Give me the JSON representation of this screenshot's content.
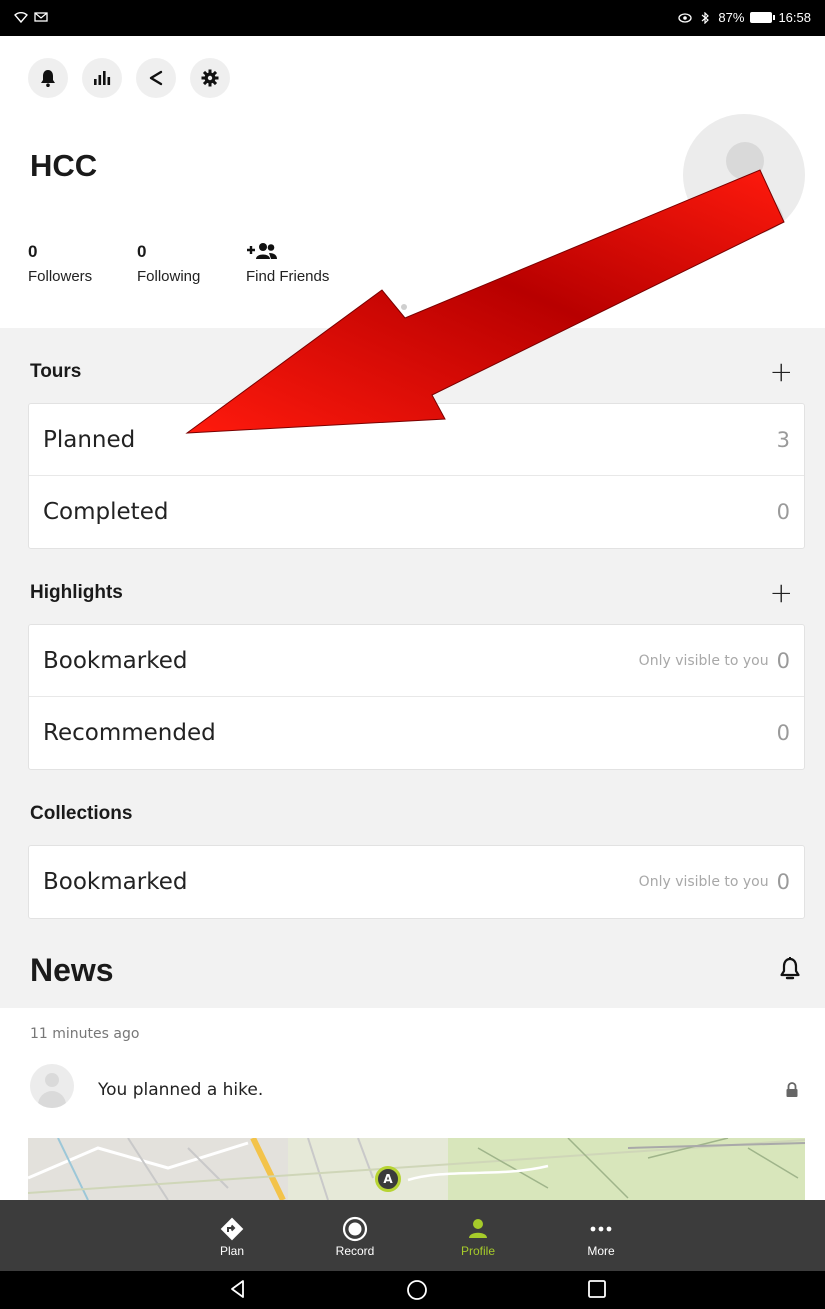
{
  "status_bar": {
    "battery": "87%",
    "time": "16:58"
  },
  "profile": {
    "username": "HCC",
    "followers_count": "0",
    "followers_label": "Followers",
    "following_count": "0",
    "following_label": "Following",
    "find_friends_label": "Find Friends"
  },
  "tours": {
    "title": "Tours",
    "rows": [
      {
        "label": "Planned",
        "count": "3"
      },
      {
        "label": "Completed",
        "count": "0"
      }
    ]
  },
  "highlights": {
    "title": "Highlights",
    "rows": [
      {
        "label": "Bookmarked",
        "note": "Only visible to you",
        "count": "0"
      },
      {
        "label": "Recommended",
        "count": "0"
      }
    ]
  },
  "collections": {
    "title": "Collections",
    "rows": [
      {
        "label": "Bookmarked",
        "note": "Only visible to you",
        "count": "0"
      }
    ]
  },
  "news": {
    "title": "News",
    "time_ago": "11 minutes ago",
    "activity_text": "You planned a hike.",
    "map_marker": "A"
  },
  "bottom_nav": {
    "items": [
      {
        "label": "Plan",
        "icon": "directions-icon"
      },
      {
        "label": "Record",
        "icon": "record-icon"
      },
      {
        "label": "Profile",
        "icon": "person-icon"
      },
      {
        "label": "More",
        "icon": "more-icon"
      }
    ]
  },
  "colors": {
    "accent": "#a6cb2a",
    "arrow": "#e10f0a",
    "nav_bg": "#3c3c3c"
  }
}
